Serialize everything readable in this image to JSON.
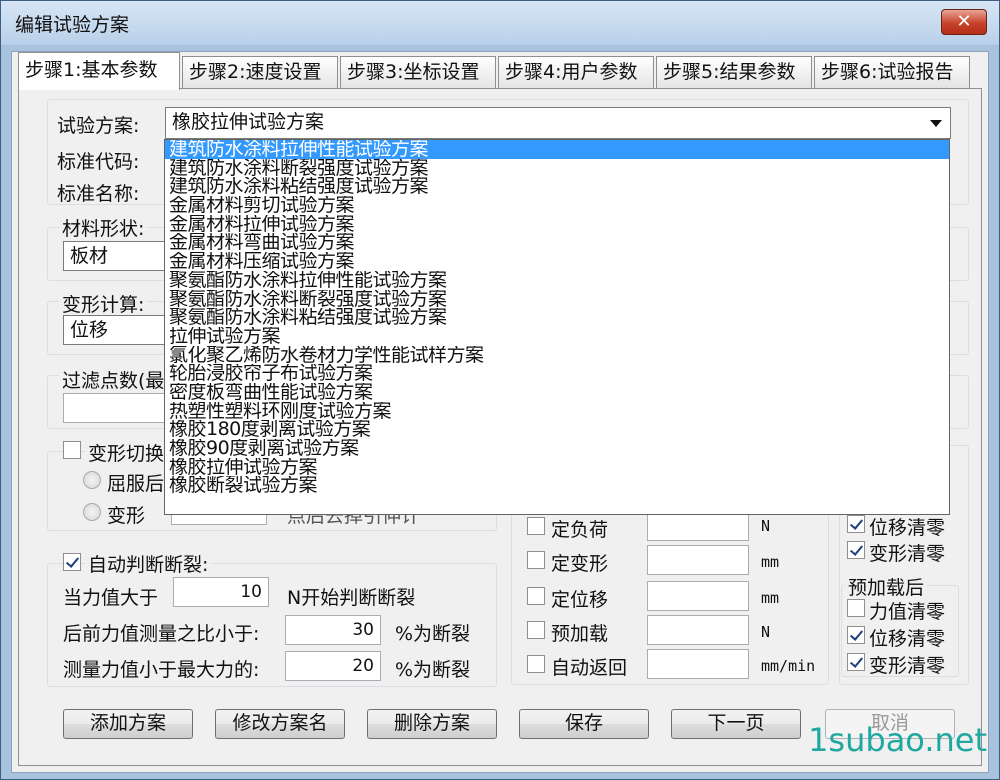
{
  "window": {
    "title": "编辑试验方案",
    "close_glyph": "✕"
  },
  "tabs": [
    {
      "label": "步骤1:基本参数"
    },
    {
      "label": "步骤2:速度设置"
    },
    {
      "label": "步骤3:坐标设置"
    },
    {
      "label": "步骤4:用户参数"
    },
    {
      "label": "步骤5:结果参数"
    },
    {
      "label": "步骤6:试验报告"
    }
  ],
  "basic": {
    "plan_label": "试验方案:",
    "plan_value": "橡胶拉伸试验方案",
    "std_code_label": "标准代码:",
    "std_name_label": "标准名称:"
  },
  "dropdown_items": [
    "建筑防水涂料拉伸性能试验方案",
    "建筑防水涂料断裂强度试验方案",
    "建筑防水涂料粘结强度试验方案",
    "金属材料剪切试验方案",
    "金属材料拉伸试验方案",
    "金属材料弯曲试验方案",
    "金属材料压缩试验方案",
    "聚氨酯防水涂料拉伸性能试验方案",
    "聚氨酯防水涂料断裂强度试验方案",
    "聚氨酯防水涂料粘结强度试验方案",
    "拉伸试验方案",
    "氯化聚乙烯防水卷材力学性能试样方案",
    "轮胎浸胶帘子布试验方案",
    "密度板弯曲性能试验方案",
    "热塑性塑料环刚度试验方案",
    "橡胶180度剥离试验方案",
    "橡胶90度剥离试验方案",
    "橡胶拉伸试验方案",
    "橡胶断裂试验方案"
  ],
  "material": {
    "label": "材料形状:",
    "value": "板材"
  },
  "deform": {
    "label": "变形计算:",
    "value": "位移"
  },
  "filter": {
    "label": "过滤点数(最"
  },
  "deform_switch": {
    "label": "变形切换",
    "opt_yield": "屈服后",
    "opt_deform": "变形",
    "trailing_text": "点后去掉引伸计"
  },
  "auto_break": {
    "label": "自动判断断裂:",
    "force_gt_label": "当力值大于",
    "force_gt_value": "10",
    "force_gt_suffix": "N开始判断断裂",
    "ratio_label": "后前力值测量之比小于:",
    "ratio_value": "30",
    "ratio_suffix": "%为断裂",
    "measure_label": "测量力值小于最大力的:",
    "measure_value": "20",
    "measure_suffix": "%为断裂"
  },
  "ctrl": {
    "fixed_load": "定负荷",
    "fixed_load_unit": "N",
    "fixed_deform": "定变形",
    "fixed_deform_unit": "mm",
    "fixed_disp": "定位移",
    "fixed_disp_unit": "mm",
    "preload": "预加载",
    "preload_unit": "N",
    "auto_return": "自动返回",
    "auto_return_unit": "mm/min"
  },
  "zero": {
    "disp_clear": "位移清零",
    "deform_clear": "变形清零",
    "after_preload_title": "预加载后",
    "force_clear": "力值清零",
    "disp_clear2": "位移清零",
    "deform_clear2": "变形清零"
  },
  "buttons": {
    "add": "添加方案",
    "rename": "修改方案名",
    "delete": "删除方案",
    "save": "保存",
    "next": "下一页",
    "cancel": "取消"
  },
  "watermark": "1subao.net"
}
